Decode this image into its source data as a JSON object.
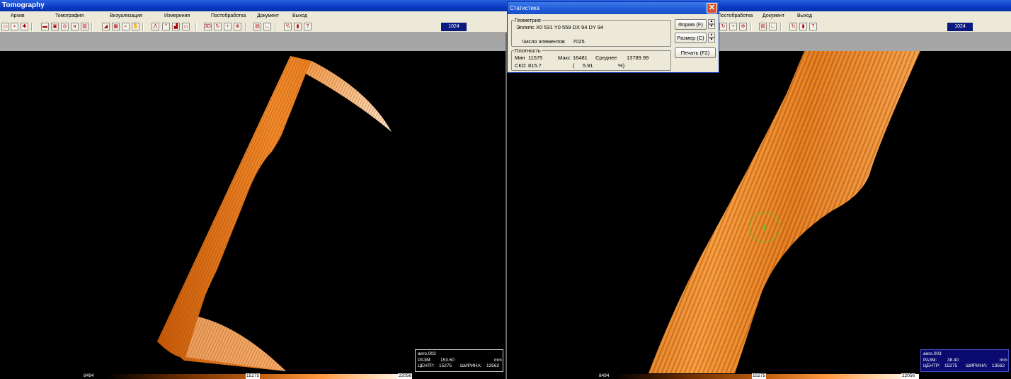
{
  "app": {
    "title": "Tomography"
  },
  "menu_left": [
    "Архив",
    "Томография",
    "Визуализация",
    "Измерения",
    "Постобработка",
    "Документ",
    "Выход"
  ],
  "menu_right": [
    "Постобработка",
    "Документ",
    "Выход"
  ],
  "toolbar": {
    "slice_number": "1024",
    "btn_3d": "3D",
    "btn_plus": "+"
  },
  "left_view": {
    "info": {
      "file": "aero.003",
      "size_label": "РАЗМ:",
      "size_value": "153.60",
      "unit": "mm",
      "center_label": "ЦЕНТР:",
      "center_value": "15275",
      "width_label": "ШИРИНА:",
      "width_value": "13562"
    },
    "scale": {
      "min": "8494",
      "mid": "15275",
      "max": "22056"
    }
  },
  "right_view": {
    "info": {
      "file": "aero.003",
      "size_label": "РАЗМ:",
      "size_value": "38.40",
      "unit": "mm",
      "center_label": "ЦЕНТР:",
      "center_value": "15275",
      "width_label": "ШИРИНА:",
      "width_value": "13562"
    },
    "scale": {
      "min": "8494",
      "mid": "15275",
      "max": "22056"
    }
  },
  "dialog": {
    "title": "Статистика",
    "geometry_label": "Геометрия",
    "geometry_line": "Эллипс   X0  531  Y0  559  DX   94  DY   94",
    "count_label": "Число элементов",
    "count_value": "7025",
    "density_label": "Плотность",
    "min_label": "Мин",
    "min_value": "11575",
    "max_label": "Макс",
    "max_value": "16481",
    "mean_label": "Среднее",
    "mean_value": "13789.99",
    "sko_label": "СКО",
    "sko_value": "815.7",
    "pct_open": "(",
    "pct_value": "5.91",
    "pct_close": "%)",
    "shape_button": "Форма (F)",
    "size_button": "Размер (C)",
    "print_button": "Печать (F2)"
  },
  "colors": {
    "title_bar": "#0a3bc4",
    "slice_box": "#0a1a80",
    "part": "#e07818",
    "crosshair": "#5ac81e"
  }
}
